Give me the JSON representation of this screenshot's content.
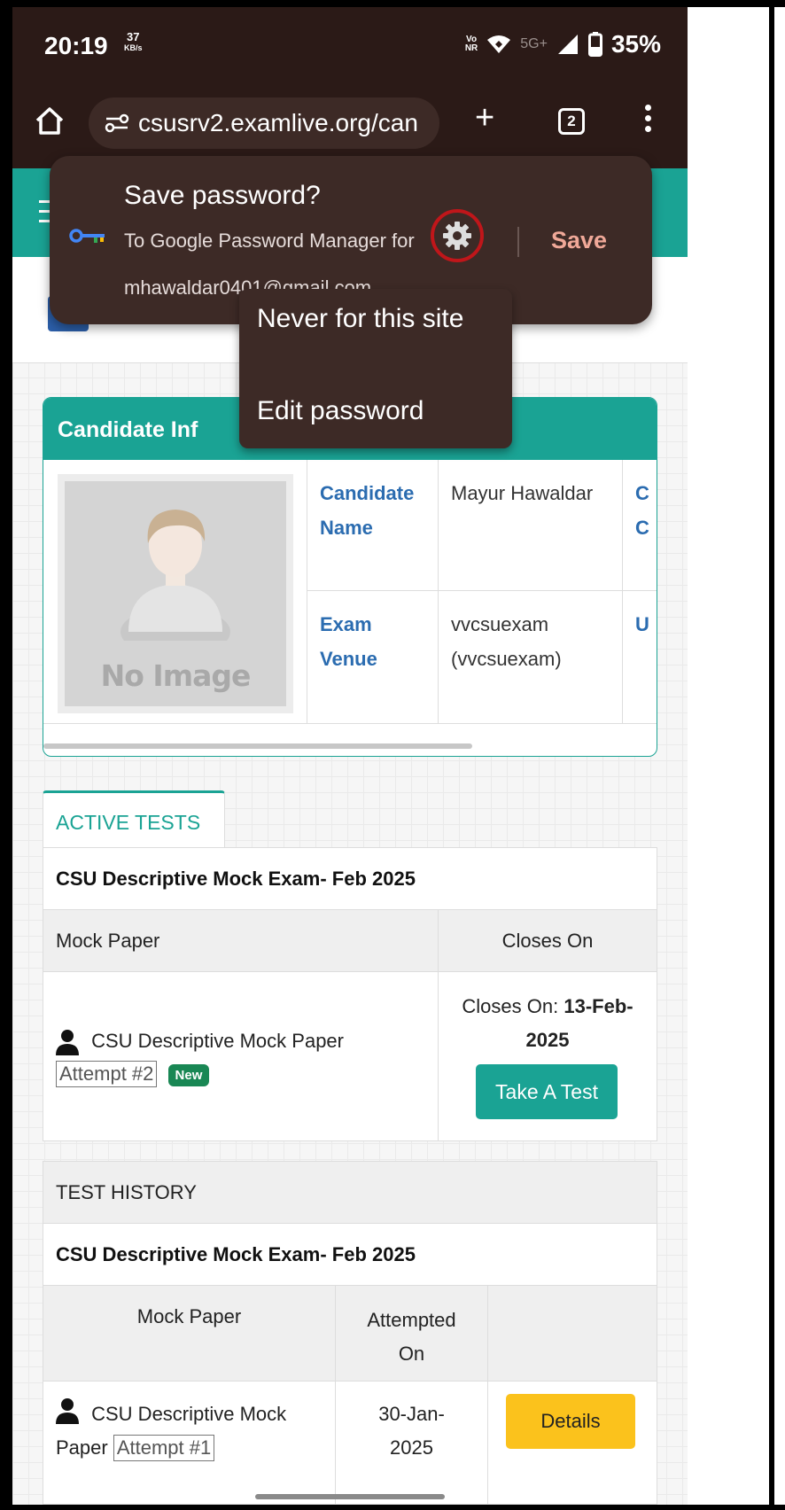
{
  "status_bar": {
    "time": "20:19",
    "net_speed_value": "37",
    "net_speed_unit": "KB/s",
    "volte_top": "Vo",
    "volte_bottom": "NR",
    "network": "5G+",
    "battery": "35%"
  },
  "browser": {
    "url": "csusrv2.examlive.org/can",
    "tab_count": "2"
  },
  "password_prompt": {
    "title": "Save password?",
    "description": "To Google Password Manager for",
    "email": "mhawaldar0401@gmail.com",
    "save_label": "Save",
    "menu": {
      "never_label": "Never for this site",
      "edit_label": "Edit password"
    }
  },
  "candidate_card": {
    "header": "Candidate Inf",
    "no_image": "No Image",
    "name_label": "Candidate Name",
    "name_value": "Mayur  Hawaldar",
    "venue_label": "Exam Venue",
    "venue_value": "vvcsuexam (vvcsuexam)",
    "cut_col_1": "C",
    "cut_col_2": "C",
    "cut_col_3": "U"
  },
  "active_tests": {
    "tab_label": "ACTIVE TESTS",
    "exam_title": "CSU Descriptive Mock Exam- Feb 2025",
    "col_paper": "Mock Paper",
    "col_closes": "Closes On",
    "paper_name": "CSU Descriptive Mock Paper",
    "attempt": "Attempt #2",
    "badge": "New",
    "closes_prefix": "Closes On:",
    "closes_date": "13-Feb-2025",
    "take_test_label": "Take A Test"
  },
  "test_history": {
    "header": "TEST HISTORY",
    "exam_title": "CSU Descriptive Mock Exam- Feb 2025",
    "col_paper": "Mock Paper",
    "col_attempted": "Attempted On",
    "paper_name": "CSU Descriptive Mock Paper",
    "attempt": "Attempt #1",
    "attempted_date": "30-Jan-2025",
    "details_label": "Details"
  },
  "colors": {
    "teal": "#1aa394",
    "browser_bg": "#2b1a17",
    "dialog_bg": "#3d2a26",
    "save_accent": "#f0a898",
    "highlight_ring": "#c0161a",
    "details_yellow": "#fbc21c",
    "badge_green": "#198754"
  }
}
